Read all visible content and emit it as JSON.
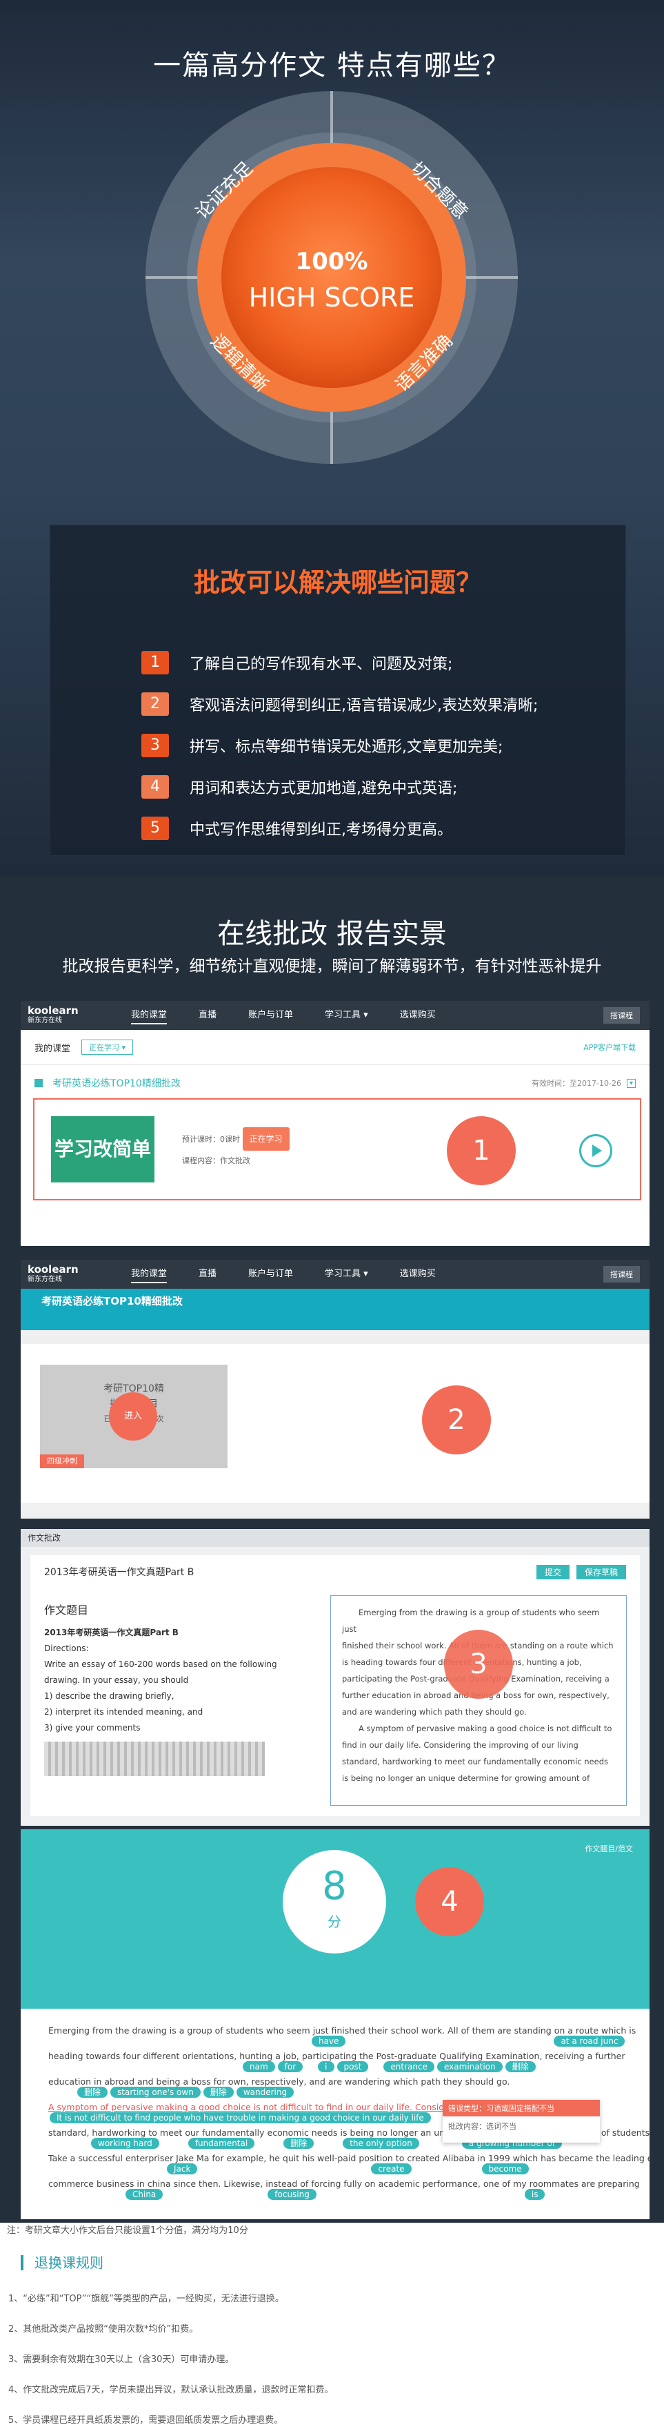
{
  "hero": {
    "title": "一篇高分作文  特点有哪些？",
    "center_line1": "100%",
    "center_line2": "HIGH SCORE",
    "quadrants": [
      "论证充足",
      "切合题意",
      "逻辑清晰",
      "语言准确"
    ]
  },
  "problems": {
    "title": "批改可以解决哪些问题？",
    "items": [
      {
        "num": "1",
        "text": "了解自己的写作现有水平、问题及对策;",
        "color": "#e8501e"
      },
      {
        "num": "2",
        "text": "客观语法问题得到纠正,语言错误减少,表达效果清晰;",
        "color": "#ee7a50"
      },
      {
        "num": "3",
        "text": "拼写、标点等细节错误无处遁形,文章更加完美;",
        "color": "#e8501e"
      },
      {
        "num": "4",
        "text": "用词和表达方式更加地道,避免中式英语;",
        "color": "#ee7a50"
      },
      {
        "num": "5",
        "text": "中式写作思维得到纠正,考场得分更高。",
        "color": "#e8501e"
      }
    ]
  },
  "showcase": {
    "title": "在线批改 报告实景",
    "subtitle": "批改报告更科学，细节统计直观便捷，瞬间了解薄弱环节，有针对性恶补提升"
  },
  "app": {
    "logo_main": "koolearn",
    "logo_sub": "新东方在线",
    "nav": [
      "我的课堂",
      "直播",
      "账户与订单",
      "学习工具 ▾",
      "选课购买"
    ],
    "settings": "搭课程"
  },
  "s1": {
    "badge": "1",
    "breadcrumb": "我的课堂",
    "filter": "正在学习 ▾",
    "app_download": "APP客户端下载",
    "course_title": "考研英语必练TOP10精细批改",
    "validity": "有效时间：至2017-10-26",
    "thumb_text": "学习改简单",
    "progress_label": "预计课时：0课时",
    "status": "正在学习",
    "content_label": "课程内容：作文批改"
  },
  "s2": {
    "badge": "2",
    "course_title": "考研英语必练TOP10精细批改",
    "card_title": "考研TOP10精",
    "card_sub": "批改作文目",
    "card_status": "已做0篇，共10次",
    "enter": "进入",
    "footer": "四级冲刺"
  },
  "s3": {
    "badge": "3",
    "window_label": "作文批改",
    "essay_title": "2013年考研英语一作文真题Part B",
    "btn_submit": "提交",
    "btn_save": "保存草稿",
    "question_heading": "作文题目",
    "question_title": "2013年考研英语一作文真题Part B",
    "question_lines": [
      "Directions:",
      "Write an essay of 160-200 words based on the following",
      "drawing. In your essay, you should",
      "1) describe the drawing briefly,",
      "2) interpret its intended meaning, and",
      "3) give your comments"
    ],
    "answer_lines": [
      "Emerging from the drawing is a group of students who seem just",
      "finished their school work. All of them are standing on a route which",
      "is heading towards four different orientations, hunting a job,",
      "participating the Post-graduate Qualifying Examination, receiving a",
      "further education in abroad and being a boss for own, respectively,",
      "and are wandering which path they should go.",
      "A symptom of pervasive making a good choice is not difficult to",
      "find in our daily life. Considering the improving of our living",
      "standard, hardworking to meet our fundamentally economic needs",
      "is being no longer an unique determine for growing amount of"
    ]
  },
  "s4": {
    "badge": "4",
    "score": "8",
    "score_unit": "分",
    "top_link": "作文题目/范文",
    "popup_title": "错误类型：习语或固定搭配不当",
    "popup_body": "批改内容：选词不当",
    "lines": [
      "Emerging from the drawing is a group of students who seem just finished their school work. All of them are standing on a route which is",
      "heading towards four different orientations, hunting a job, participating the Post-graduate Qualifying Examination, receiving a further",
      "education in abroad and being a boss for own, respectively, and are wandering which path they should go.",
      "A symptom of pervasive making a good choice is not difficult to find in our daily life. Considering the improving of our living",
      "standard, hardworking to meet our fundamentally economic needs is being no longer an unique determine for growing amount of students.",
      "Take a successful enterpriser Jake Ma for example, he quit his well-paid position to created Alibaba in 1999 which has became the leading e-",
      "commerce business in china since then. Likewise, instead of forcing fully on academic performance, one of my roommates are preparing"
    ],
    "pills": [
      "have",
      "at a road junc",
      "nam",
      "for",
      "i",
      "post",
      "entrance",
      "examination",
      "删除",
      "starting one's own",
      "wandering",
      "It is not difficult to find people who have trouble in making a good choice in our daily life",
      "working hard",
      "fundamental",
      "the only option",
      "a growing number of",
      "Jack",
      "create",
      "become",
      "China",
      "focusing",
      "is"
    ]
  },
  "rules": {
    "note": "注：考研文章大小作文后台只能设置1个分值，满分均为10分",
    "heading": "退换课规则",
    "items": [
      "1、“必练”和“TOP”“旗舰”等类型的产品，一经购买，无法进行退换。",
      "2、其他批改类产品按照“使用次数*均价”扣费。",
      "3、需要剩余有效期在30天以上（含30天）可申请办理。",
      "4、作文批改完成后7天，学员未提出异议，默认承认批改质量，退款时正常扣费。",
      "5、学员课程已经开具纸质发票的，需要退回纸质发票之后办理退费。"
    ]
  }
}
